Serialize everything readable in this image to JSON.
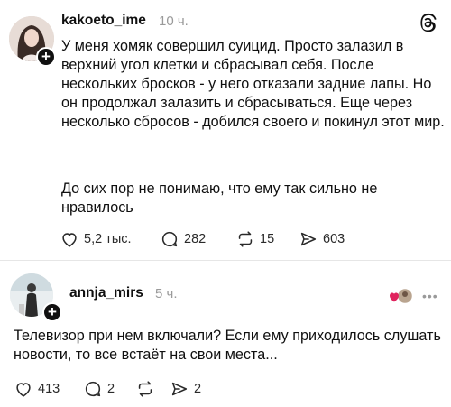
{
  "app": {
    "logo_icon": "threads-logo-icon"
  },
  "posts": [
    {
      "author": {
        "username": "kakoeto_ime",
        "avatar_icon": "avatar-photo",
        "follow_badge": "+"
      },
      "time": "10 ч.",
      "text_paragraphs": [
        "У меня хомяк совершил суицид. Просто залазил в верхний угол клетки и сбрасывал себя. После нескольких бросков - у него отказали задние лапы. Но он продолжал залазить и сбрасываться. Еще через несколько сбросов - добился своего и покинул этот мир.",
        "До сих пор не понимаю, что ему так сильно не нравилось"
      ],
      "actions": {
        "likes": "5,2 тыс.",
        "replies": "282",
        "reposts": "15",
        "shares": "603"
      }
    },
    {
      "author": {
        "username": "annja_mirs",
        "avatar_icon": "avatar-photo",
        "follow_badge": "+"
      },
      "time": "5 ч.",
      "text": "Телевизор при нем включали? Если ему приходилось слушать новости, то все встаёт на свои места...",
      "liked_by_icon": "liked-by-avatars",
      "more_icon": "more-icon",
      "more_glyph": "•••",
      "actions": {
        "likes": "413",
        "replies": "2",
        "reposts": "",
        "shares": "2"
      }
    }
  ],
  "colors": {
    "text": "#101010",
    "muted": "#9a9a9a",
    "like_heart": "#e0245e"
  }
}
